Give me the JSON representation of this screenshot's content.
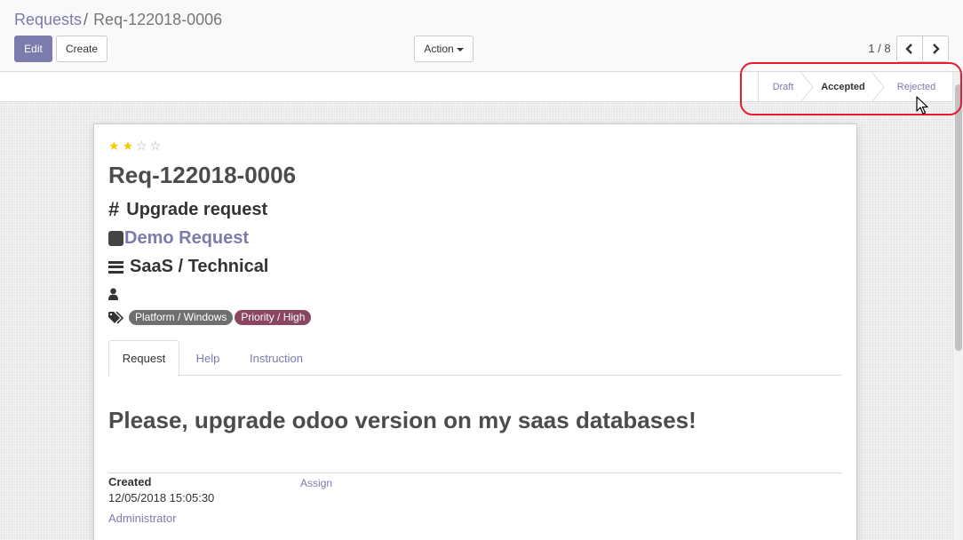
{
  "breadcrumb": {
    "parent": "Requests",
    "separator": "/",
    "current": "Req-122018-0006"
  },
  "toolbar": {
    "edit_label": "Edit",
    "create_label": "Create",
    "action_label": "Action"
  },
  "pager": {
    "value": "1 / 8"
  },
  "statusbar": {
    "stages": [
      "Draft",
      "Accepted",
      "Rejected"
    ],
    "current_stage": "Accepted"
  },
  "record": {
    "rating": 2,
    "rating_max": 5,
    "name": "Req-122018-0006",
    "type": "Upgrade request",
    "service": "Demo Request",
    "category": "SaaS / Technical",
    "tags": [
      {
        "label": "Platform / Windows",
        "color": "#6f6f6f"
      },
      {
        "label": "Priority / High",
        "color": "#8a4561"
      }
    ]
  },
  "tabs": {
    "request": "Request",
    "help": "Help",
    "instruction": "Instruction"
  },
  "request_text": "Please, upgrade odoo version on my saas databases!",
  "info": {
    "created_label": "Created",
    "created_value": "12/05/2018 15:05:30",
    "created_by": "Administrator",
    "assign_label": "Assign"
  },
  "colors": {
    "accent": "#7c7bad",
    "highlight": "#e8192c",
    "star": "#f3cc00"
  }
}
